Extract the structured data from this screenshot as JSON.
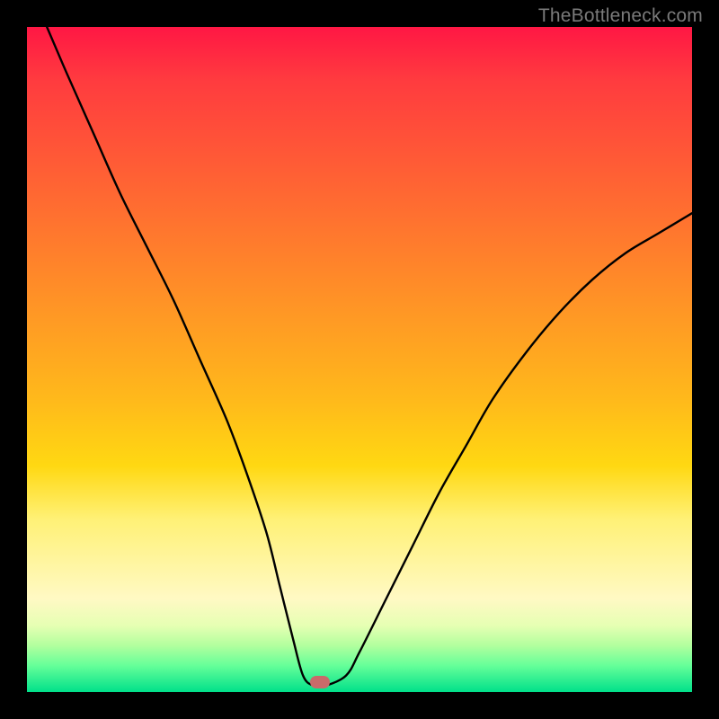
{
  "watermark": "TheBottleneck.com",
  "chart_data": {
    "type": "line",
    "title": "",
    "xlabel": "",
    "ylabel": "",
    "xlim": [
      0,
      100
    ],
    "ylim": [
      0,
      100
    ],
    "grid": false,
    "legend": false,
    "series": [
      {
        "name": "curve",
        "color": "#000000",
        "x": [
          3,
          6,
          10,
          14,
          18,
          22,
          26,
          30,
          33,
          36,
          38,
          40,
          41.5,
          43,
          45,
          48,
          50,
          54,
          58,
          62,
          66,
          70,
          75,
          80,
          85,
          90,
          95,
          100
        ],
        "y": [
          100,
          93,
          84,
          75,
          67,
          59,
          50,
          41,
          33,
          24,
          16,
          8,
          2.5,
          1,
          1,
          2.5,
          6,
          14,
          22,
          30,
          37,
          44,
          51,
          57,
          62,
          66,
          69,
          72
        ]
      }
    ],
    "marker": {
      "x": 44,
      "y": 1.5,
      "color": "#c96a6a"
    }
  }
}
